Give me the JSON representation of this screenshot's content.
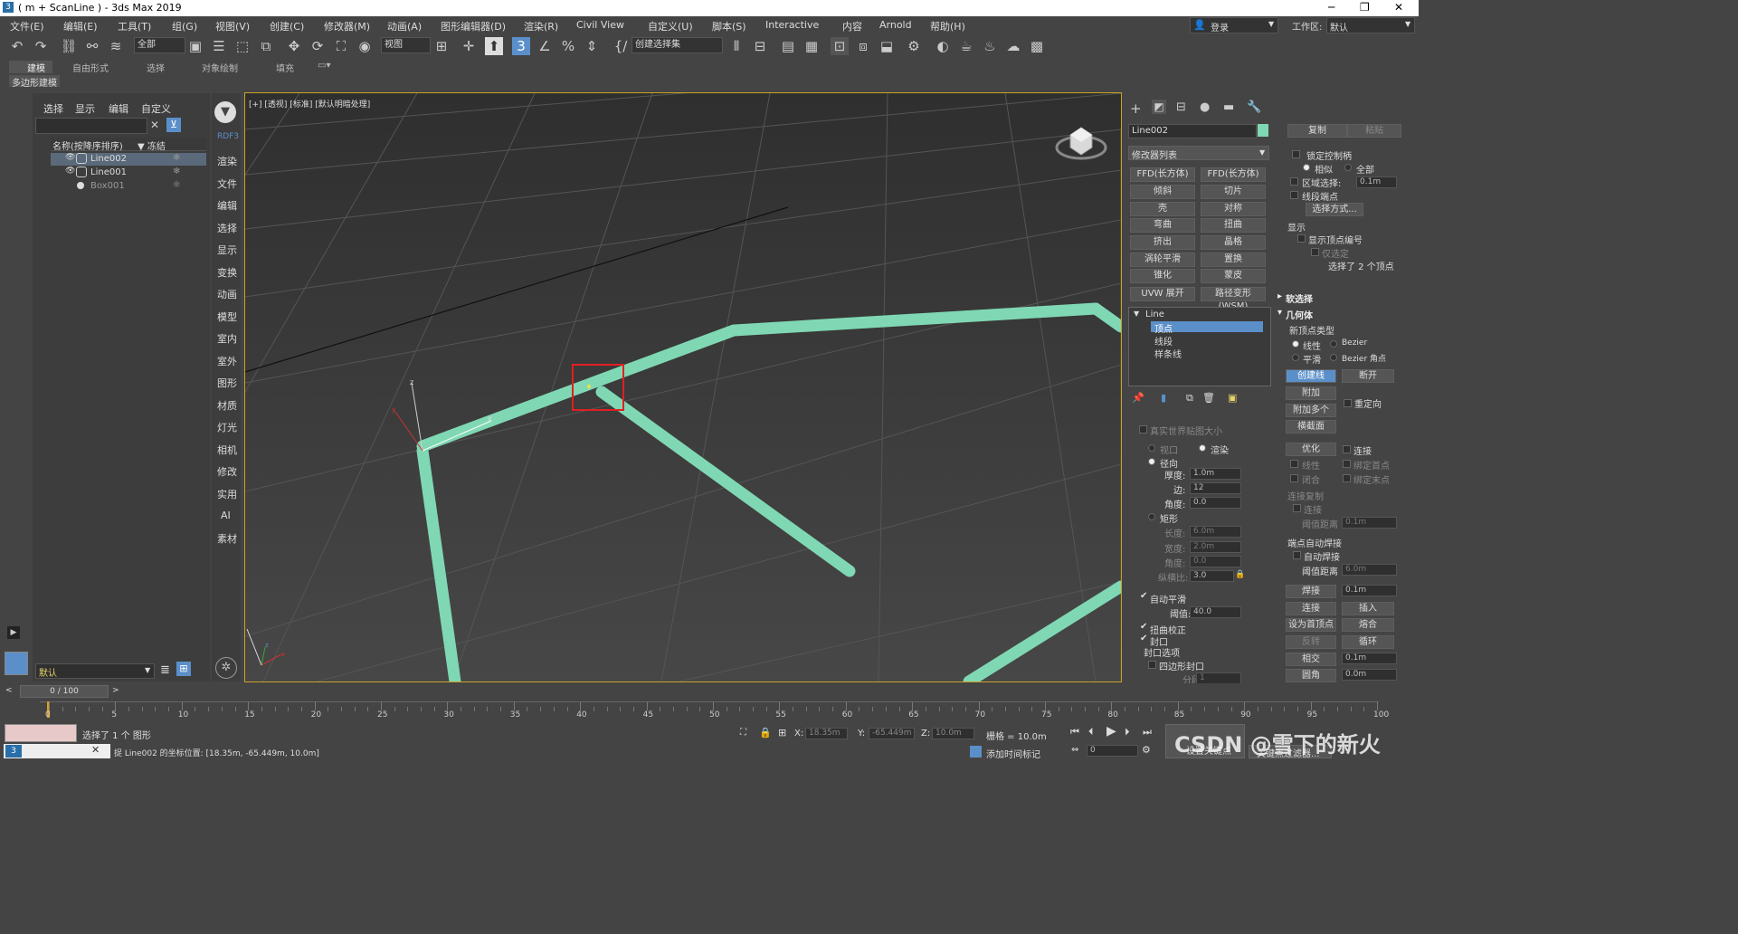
{
  "window": {
    "title": "( m + ScanLine ) - 3ds Max 2019",
    "minimize": "─",
    "maximize": "❐",
    "close": "✕"
  },
  "menu": [
    "文件(E)",
    "编辑(E)",
    "工具(T)",
    "组(G)",
    "视图(V)",
    "创建(C)",
    "修改器(M)",
    "动画(A)",
    "图形编辑器(D)",
    "渲染(R)",
    "Civil View",
    "自定义(U)",
    "脚本(S)",
    "Interactive",
    "内容",
    "Arnold",
    "帮助(H)"
  ],
  "account": {
    "login": "登录",
    "workspace_label": "工作区:",
    "workspace_value": "默认"
  },
  "toolbar": {
    "filter_select": "全部",
    "view_select": "视图",
    "selection_set": "创建选择集"
  },
  "ribbon": {
    "tabs": [
      "建模",
      "自由形式",
      "选择",
      "对象绘制",
      "填充"
    ],
    "sub": "多边形建模"
  },
  "explorer": {
    "menu": [
      "选择",
      "显示",
      "编辑",
      "自定义"
    ],
    "col_name": "名称(按降序排序)",
    "col_freeze": "▼ 冻结",
    "rows": [
      {
        "name": "Line002",
        "selected": true
      },
      {
        "name": "Line001",
        "selected": false
      },
      {
        "name": "Box001",
        "selected": false
      }
    ],
    "layer": "默认"
  },
  "sidetabs": [
    "RDF3",
    "渲染",
    "文件",
    "编辑",
    "选择",
    "显示",
    "变换",
    "动画",
    "模型",
    "室内",
    "室外",
    "图形",
    "材质",
    "灯光",
    "相机",
    "修改",
    "实用",
    "AI",
    "素材"
  ],
  "viewport": {
    "label": "[+] [透视] [标准] [默认明暗处理]"
  },
  "modify": {
    "object_name": "Line002",
    "modifier_list": "修改器列表",
    "buttons": [
      "FFD(长方体)",
      "FFD(长方体)",
      "倾斜",
      "切片",
      "壳",
      "对称",
      "弯曲",
      "扭曲",
      "挤出",
      "晶格",
      "涡轮平滑",
      "置换",
      "锥化",
      "蒙皮",
      "UVW 展开",
      "路径变形 (WSM)"
    ],
    "stack": {
      "root": "Line",
      "items": [
        "顶点",
        "线段",
        "样条线"
      ]
    },
    "real_world": "真实世界贴图大小",
    "viewport_opt": "视口",
    "render_opt": "渲染",
    "radial": "径向",
    "thickness_label": "厚度:",
    "thickness": "1.0m",
    "sides_label": "边:",
    "sides": "12",
    "angle_label": "角度:",
    "angle": "0.0",
    "rect": "矩形",
    "length_label": "长度:",
    "length": "6.0m",
    "width_label": "宽度:",
    "width": "2.0m",
    "angle2_label": "角度:",
    "angle2": "0.0",
    "aspect_label": "纵横比:",
    "aspect": "3.0",
    "auto_smooth": "自动平滑",
    "threshold_label": "阈值:",
    "threshold": "40.0",
    "twist_fix": "扭曲校正",
    "cap": "封口",
    "cap_options": "封口选项",
    "quad_cap": "四边形封口",
    "segments_label": "分段:",
    "segments": "1"
  },
  "selection": {
    "copy": "复制",
    "paste": "粘贴",
    "lock_handles": "锁定控制柄",
    "similar": "相似",
    "all": "全部",
    "area_select": "区域选择:",
    "area_value": "0.1m",
    "segment_end": "线段端点",
    "select_by": "选择方式...",
    "display": "显示",
    "show_vertex_numbers": "显示顶点编号",
    "only_selected": "仅选定",
    "status": "选择了 2 个顶点"
  },
  "soft_selection": "软选择",
  "geometry": {
    "title": "几何体",
    "new_vertex_type": "新顶点类型",
    "linear": "线性",
    "bezier": "Bezier",
    "smooth": "平滑",
    "bezier_corner": "Bezier 角点",
    "create_line": "创建线",
    "break": "断开",
    "attach": "附加",
    "reorient": "重定向",
    "attach_multiple": "附加多个",
    "cross_section": "横截面",
    "refine": "优化",
    "connect": "连接",
    "linear2": "线性",
    "bind_first": "绑定首点",
    "closed": "闭合",
    "bind_last": "绑定末点",
    "connect_copy": "连接复制",
    "connect2": "连接",
    "threshold_dist": "阈值距离",
    "threshold_dist_value": "0.1m",
    "end_auto_weld": "端点自动焊接",
    "auto_weld": "自动焊接",
    "weld_threshold": "阈值距离",
    "weld_threshold_value": "6.0m",
    "weld": "焊接",
    "weld_value": "0.1m",
    "connect3": "连接",
    "insert": "插入",
    "make_first": "设为首顶点",
    "fuse": "熔合",
    "reverse": "反转",
    "cycle": "循环",
    "cross_insert": "相交",
    "cross_value": "0.1m",
    "fillet": "圆角",
    "fillet_value": "0.0m"
  },
  "timeline": {
    "frame": "0 / 100",
    "ticks": [
      0,
      5,
      10,
      15,
      20,
      25,
      30,
      35,
      40,
      45,
      50,
      55,
      60,
      65,
      70,
      75,
      80,
      85,
      90,
      95,
      100
    ]
  },
  "status": {
    "selected": "选择了 1 个 图形",
    "coords_msg": "捉 Line002 的坐标位置: [18.35m, -65.449m, 10.0m]",
    "x_label": "X:",
    "x": "18.35m",
    "y_label": "Y:",
    "y": "-65.449m",
    "z_label": "Z:",
    "z": "10.0m",
    "grid": "栅格 = 10.0m",
    "add_tag": "添加时间标记",
    "frame_field": "0",
    "set_key": "设置关键点",
    "key_filter": "关键点过滤器...",
    "watermark": "CSDN @雪下的新火"
  },
  "colors": {
    "accent": "#5b8fc9",
    "pipe": "#7fd8b3",
    "selection": "#e02020",
    "viewport_border": "#c9a227"
  }
}
